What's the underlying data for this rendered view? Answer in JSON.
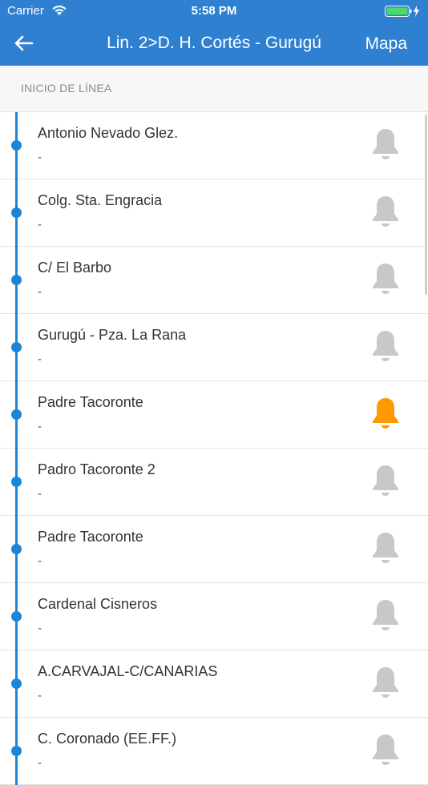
{
  "status_bar": {
    "carrier": "Carrier",
    "time": "5:58 PM",
    "battery_color": "#4cd964"
  },
  "nav": {
    "back_icon": "arrow-left-icon",
    "title": "Lin. 2>D. H. Cortés - Gurugú",
    "map_label": "Mapa"
  },
  "section": {
    "label": "INICIO DE LÍNEA"
  },
  "colors": {
    "nav_bg": "#2f80d0",
    "line": "#1a86d8",
    "bell_inactive": "#c8c8c8",
    "bell_active": "#ff9900"
  },
  "stops": [
    {
      "name": "Antonio Nevado Glez.",
      "sub": "-",
      "alert_active": false
    },
    {
      "name": "Colg. Sta. Engracia",
      "sub": "-",
      "alert_active": false
    },
    {
      "name": "C/ El Barbo",
      "sub": "-",
      "alert_active": false
    },
    {
      "name": "Gurugú - Pza. La Rana",
      "sub": "-",
      "alert_active": false
    },
    {
      "name": "Padre Tacoronte",
      "sub": "-",
      "alert_active": true
    },
    {
      "name": "Padro Tacoronte 2",
      "sub": "-",
      "alert_active": false
    },
    {
      "name": "Padre Tacoronte",
      "sub": "-",
      "alert_active": false
    },
    {
      "name": "Cardenal Cisneros",
      "sub": "-",
      "alert_active": false
    },
    {
      "name": "A.CARVAJAL-C/CANARIAS",
      "sub": "-",
      "alert_active": false
    },
    {
      "name": "C. Coronado (EE.FF.)",
      "sub": "-",
      "alert_active": false
    }
  ]
}
